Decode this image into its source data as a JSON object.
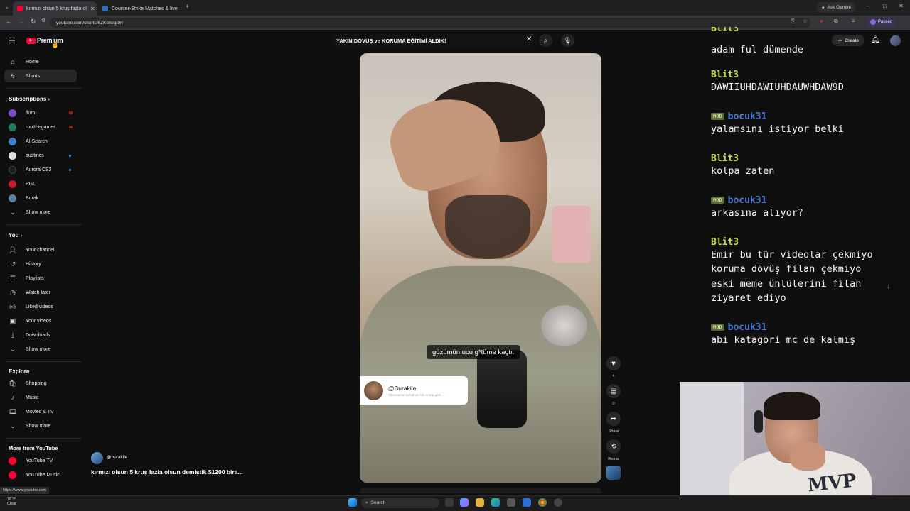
{
  "browser": {
    "tabs": [
      {
        "label": "kırmızı olsun 5 kruş fazla ol",
        "active": true
      },
      {
        "label": "Counter-Strike Matches & live",
        "active": false
      }
    ],
    "url": "youtube.com/shorts/6ZKetsnp9rI",
    "ask_gemini": "Ask Gemini",
    "profile_status": "Paused"
  },
  "youtube": {
    "logo": "Premium",
    "search_query": "YAKIN DÖVÜŞ ve KORUMA EĞİTİMİ ALDIK!",
    "create_label": "Create",
    "sidebar": {
      "home": "Home",
      "shorts": "Shorts",
      "subscriptions_header": "Subscriptions",
      "subscriptions": [
        {
          "label": "fl0m",
          "color": "#7a4cc2",
          "live": true
        },
        {
          "label": "rootthegamer",
          "color": "#1f7a57",
          "live": true
        },
        {
          "label": "AI Search",
          "color": "#3f7fc7",
          "live": false
        },
        {
          "label": "austincs",
          "color": "#dedede",
          "new": true
        },
        {
          "label": "Aurora CS2",
          "color": "#1c1c1c",
          "new": true
        },
        {
          "label": "PGL",
          "color": "#c4182b",
          "live": false
        },
        {
          "label": "Burak",
          "color": "#5d7fa3",
          "live": false
        }
      ],
      "subs_show_more": "Show more",
      "you_header": "You",
      "you_items": [
        "Your channel",
        "History",
        "Playlists",
        "Watch later",
        "Liked videos",
        "Your videos",
        "Downloads"
      ],
      "you_show_more": "Show more",
      "explore_header": "Explore",
      "explore_items": [
        "Shopping",
        "Music",
        "Movies & TV"
      ],
      "explore_show_more": "Show more",
      "more_header": "More from YouTube",
      "more_items": [
        "YouTube TV",
        "YouTube Music"
      ]
    },
    "short": {
      "subtitle": "gözümün ucu g*tüme kaçtı.",
      "mention_handle": "@Burakile",
      "mention_sub": "Videosunun tamamını izle sonra gele ...",
      "channel": "@burakile",
      "title": "kırmızı olsun 5 kruş fazla olsun demiştik $1200 bira...",
      "likes": "4",
      "comments": "0",
      "share_label": "Share",
      "remix_label": "Remix"
    }
  },
  "chat": [
    {
      "user": "Blit3",
      "mod": false,
      "color": "#c7d94a",
      "text": [
        "adam ful dümende"
      ]
    },
    {
      "user": "Blit3",
      "mod": false,
      "color": "#c7d94a",
      "text": [
        "DAWIIUHDAWIUHDAUWHDAW9D"
      ]
    },
    {
      "user": "bocuk31",
      "mod": true,
      "color": "#4c7bd1",
      "text": [
        "yalamsını istiyor belki"
      ]
    },
    {
      "user": "Blit3",
      "mod": false,
      "color": "#c7d94a",
      "text": [
        "kolpa zaten"
      ]
    },
    {
      "user": "bocuk31",
      "mod": true,
      "color": "#4c7bd1",
      "text": [
        "arkasına alıyor?"
      ]
    },
    {
      "user": "Blit3",
      "mod": false,
      "color": "#c7d94a",
      "text": [
        "Emir bu tür videolar çekmiyo",
        "koruma dövüş filan çekmiyo",
        "eski meme ünlülerini filan",
        "ziyaret ediyo"
      ]
    },
    {
      "user": "bocuk31",
      "mod": true,
      "color": "#4c7bd1",
      "text": [
        "abi katagori mc de kalmış"
      ]
    }
  ],
  "chat_top_partial": "Blit3",
  "mod_badge": "MOD",
  "webcam_shirt_text": "MVP",
  "taskbar": {
    "weather_temp": "78°F",
    "weather_desc": "Clear",
    "search_label": "Search",
    "status_url": "https://www.youtube.com"
  }
}
